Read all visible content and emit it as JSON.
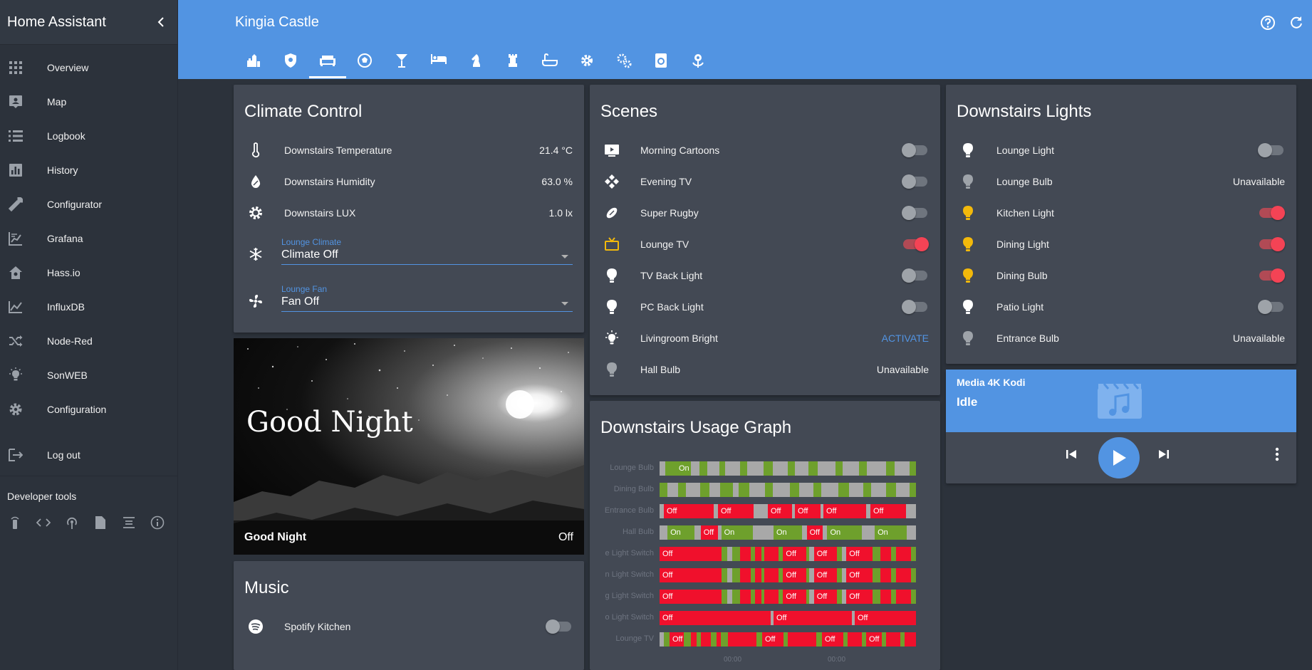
{
  "app": {
    "title": "Home Assistant",
    "house_name": "Kingia Castle"
  },
  "sidebar": {
    "items": [
      {
        "label": "Overview",
        "icon": "apps-icon"
      },
      {
        "label": "Map",
        "icon": "map-icon"
      },
      {
        "label": "Logbook",
        "icon": "logbook-icon"
      },
      {
        "label": "History",
        "icon": "history-icon"
      },
      {
        "label": "Configurator",
        "icon": "wrench-icon"
      },
      {
        "label": "Grafana",
        "icon": "grafana-icon"
      },
      {
        "label": "Hass.io",
        "icon": "hassio-icon"
      },
      {
        "label": "InfluxDB",
        "icon": "chart-icon"
      },
      {
        "label": "Node-Red",
        "icon": "shuffle-icon"
      },
      {
        "label": "SonWEB",
        "icon": "lightbulb-icon"
      },
      {
        "label": "Configuration",
        "icon": "gear-icon"
      },
      {
        "label": "Log out",
        "icon": "logout-icon"
      }
    ],
    "developer_tools": "Developer tools"
  },
  "climate": {
    "title": "Climate Control",
    "sensors": [
      {
        "name": "Downstairs Temperature",
        "value": "21.4 °C"
      },
      {
        "name": "Downstairs Humidity",
        "value": "63.0 %"
      },
      {
        "name": "Downstairs LUX",
        "value": "1.0 lx"
      }
    ],
    "lounge_climate": {
      "label": "Lounge Climate",
      "value": "Climate Off"
    },
    "lounge_fan": {
      "label": "Lounge Fan",
      "value": "Fan Off"
    }
  },
  "good_night": {
    "image_text": "Good Night",
    "name": "Good Night",
    "state": "Off"
  },
  "music": {
    "title": "Music",
    "items": [
      {
        "name": "Spotify Kitchen",
        "on": false
      }
    ]
  },
  "scenes": {
    "title": "Scenes",
    "items": [
      {
        "name": "Morning Cartoons",
        "type": "toggle",
        "on": false
      },
      {
        "name": "Evening TV",
        "type": "toggle",
        "on": false
      },
      {
        "name": "Super Rugby",
        "type": "toggle",
        "on": false
      },
      {
        "name": "Lounge TV",
        "type": "toggle",
        "on": true
      },
      {
        "name": "TV Back Light",
        "type": "toggle",
        "on": false
      },
      {
        "name": "PC Back Light",
        "type": "toggle",
        "on": false
      },
      {
        "name": "Livingroom Bright",
        "type": "action",
        "value": "ACTIVATE"
      },
      {
        "name": "Hall Bulb",
        "type": "state",
        "value": "Unavailable"
      }
    ]
  },
  "usage_graph": {
    "title": "Downstairs Usage Graph",
    "rows": [
      "Lounge Bulb",
      "Dining Bulb",
      "Entrance Bulb",
      "Hall Bulb",
      "e Light Switch",
      "n Light Switch",
      "g Light Switch",
      "o Light Switch",
      "Lounge TV"
    ],
    "x_ticks": [
      "00:00",
      "00:00"
    ],
    "state_on": "On",
    "state_off": "Off"
  },
  "lights": {
    "title": "Downstairs Lights",
    "items": [
      {
        "name": "Lounge Light",
        "type": "toggle",
        "on": false
      },
      {
        "name": "Lounge Bulb",
        "type": "state",
        "value": "Unavailable"
      },
      {
        "name": "Kitchen Light",
        "type": "toggle",
        "on": true
      },
      {
        "name": "Dining Light",
        "type": "toggle",
        "on": true
      },
      {
        "name": "Dining Bulb",
        "type": "toggle",
        "on": true
      },
      {
        "name": "Patio Light",
        "type": "toggle",
        "on": false
      },
      {
        "name": "Entrance Bulb",
        "type": "state",
        "value": "Unavailable"
      }
    ]
  },
  "media": {
    "name": "Media 4K Kodi",
    "state": "Idle"
  },
  "colors": {
    "accent": "#5294e2",
    "on_red": "#f44355",
    "graph_green": "#6ea02c",
    "graph_red": "#f0102c",
    "graph_grey": "#a8a8a8",
    "bulb_yellow": "#f3b90b"
  }
}
